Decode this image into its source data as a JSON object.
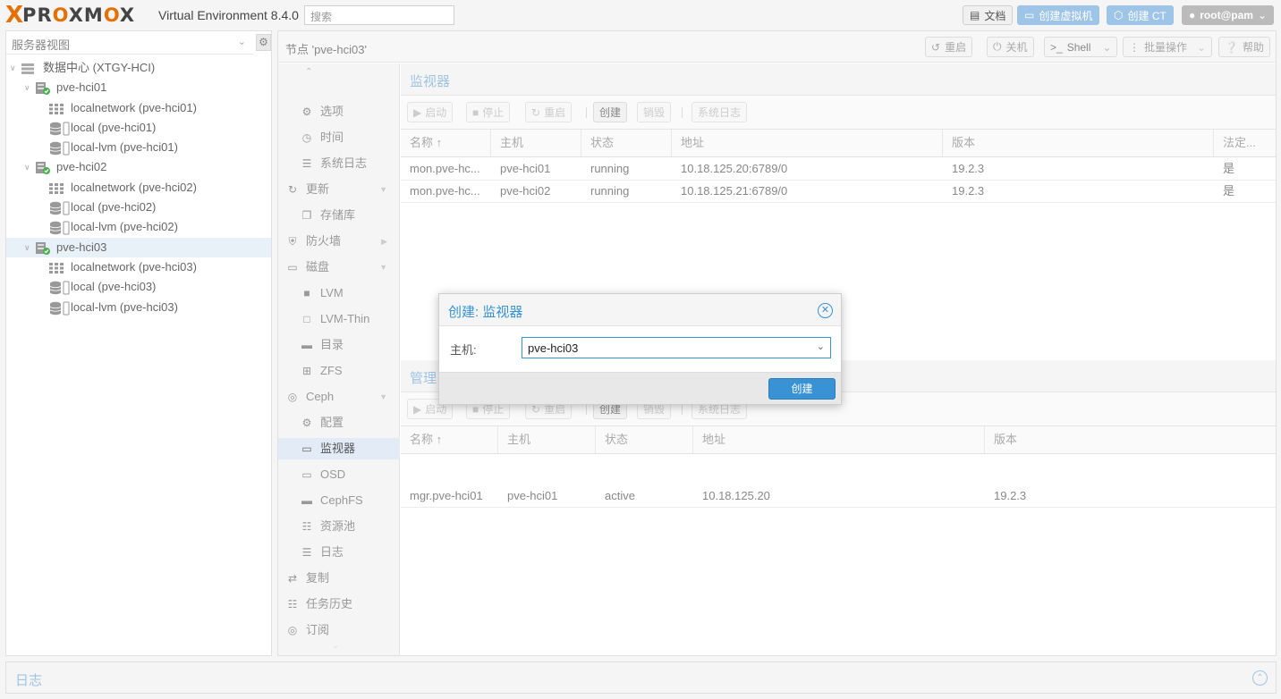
{
  "header": {
    "logo_x": "X",
    "logo_parts": [
      "PR",
      "O",
      "XM",
      "O",
      "X"
    ],
    "product": "Virtual Environment 8.4.0",
    "search_placeholder": "搜索",
    "docs_label": "文档",
    "create_vm_label": "创建虚拟机",
    "create_ct_label": "创建 CT",
    "user_label": "root@pam"
  },
  "sidebar": {
    "view_label": "服务器视图",
    "tree": [
      {
        "label": "数据中心 (XTGY-HCI)",
        "level": 0,
        "kind": "datacenter"
      },
      {
        "label": "pve-hci01",
        "level": 1,
        "kind": "node"
      },
      {
        "label": "localnetwork (pve-hci01)",
        "level": 2,
        "kind": "network"
      },
      {
        "label": "local (pve-hci01)",
        "level": 2,
        "kind": "storage"
      },
      {
        "label": "local-lvm (pve-hci01)",
        "level": 2,
        "kind": "storage"
      },
      {
        "label": "pve-hci02",
        "level": 1,
        "kind": "node"
      },
      {
        "label": "localnetwork (pve-hci02)",
        "level": 2,
        "kind": "network"
      },
      {
        "label": "local (pve-hci02)",
        "level": 2,
        "kind": "storage"
      },
      {
        "label": "local-lvm (pve-hci02)",
        "level": 2,
        "kind": "storage"
      },
      {
        "label": "pve-hci03",
        "level": 1,
        "kind": "node",
        "selected": true
      },
      {
        "label": "localnetwork (pve-hci03)",
        "level": 2,
        "kind": "network"
      },
      {
        "label": "local (pve-hci03)",
        "level": 2,
        "kind": "storage"
      },
      {
        "label": "local-lvm (pve-hci03)",
        "level": 2,
        "kind": "storage"
      }
    ]
  },
  "nodebar": {
    "title": "节点 'pve-hci03'",
    "reboot": "重启",
    "shutdown": "关机",
    "shell": "Shell",
    "bulk": "批量操作",
    "help": "帮助"
  },
  "nav": [
    {
      "label": "选项",
      "icon": "gear-icon",
      "sub": true
    },
    {
      "label": "时间",
      "icon": "clock-icon",
      "sub": true
    },
    {
      "label": "系统日志",
      "icon": "list-icon",
      "sub": true
    },
    {
      "label": "更新",
      "icon": "refresh-icon",
      "sub": false,
      "caret": "down"
    },
    {
      "label": "存储库",
      "icon": "copy-icon",
      "sub": true
    },
    {
      "label": "防火墙",
      "icon": "shield-icon",
      "sub": false,
      "caret": "right"
    },
    {
      "label": "磁盘",
      "icon": "drive-icon",
      "sub": false,
      "caret": "down"
    },
    {
      "label": "LVM",
      "icon": "square-icon",
      "sub": true
    },
    {
      "label": "LVM-Thin",
      "icon": "square-outline-icon",
      "sub": true
    },
    {
      "label": "目录",
      "icon": "folder-icon",
      "sub": true
    },
    {
      "label": "ZFS",
      "icon": "grid-icon",
      "sub": true
    },
    {
      "label": "Ceph",
      "icon": "ceph-icon",
      "sub": false,
      "caret": "down"
    },
    {
      "label": "配置",
      "icon": "gear-icon",
      "sub": true
    },
    {
      "label": "监视器",
      "icon": "monitor-icon",
      "sub": true,
      "selected": true
    },
    {
      "label": "OSD",
      "icon": "drive-icon",
      "sub": true
    },
    {
      "label": "CephFS",
      "icon": "folder-icon",
      "sub": true
    },
    {
      "label": "资源池",
      "icon": "sitemap-icon",
      "sub": true
    },
    {
      "label": "日志",
      "icon": "list-icon",
      "sub": true
    },
    {
      "label": "复制",
      "icon": "retweet-icon",
      "sub": false
    },
    {
      "label": "任务历史",
      "icon": "list-alt-icon",
      "sub": false
    },
    {
      "label": "订阅",
      "icon": "support-icon",
      "sub": false
    }
  ],
  "monitor": {
    "title": "监视器",
    "toolbar": {
      "start": "启动",
      "stop": "停止",
      "restart": "重启",
      "create": "创建",
      "destroy": "销毁",
      "syslog": "系统日志"
    },
    "columns": [
      "名称 ↑",
      "主机",
      "状态",
      "地址",
      "版本",
      "法定..."
    ],
    "rows": [
      [
        "mon.pve-hc...",
        "pve-hci01",
        "running",
        "10.18.125.20:6789/0",
        "19.2.3",
        "是"
      ],
      [
        "mon.pve-hc...",
        "pve-hci02",
        "running",
        "10.18.125.21:6789/0",
        "19.2.3",
        "是"
      ]
    ]
  },
  "manager": {
    "title": "管理",
    "toolbar": {
      "start": "启动",
      "stop": "停止",
      "restart": "重启",
      "create": "创建",
      "destroy": "销毁",
      "syslog": "系统日志"
    },
    "columns": [
      "名称 ↑",
      "主机",
      "状态",
      "地址",
      "版本"
    ],
    "rows": [
      [
        "mgr.pve-hci01",
        "pve-hci01",
        "active",
        "10.18.125.20",
        "19.2.3"
      ]
    ]
  },
  "log": {
    "title": "日志"
  },
  "dialog": {
    "title": "创建: 监视器",
    "host_label": "主机:",
    "host_value": "pve-hci03",
    "submit": "创建"
  }
}
